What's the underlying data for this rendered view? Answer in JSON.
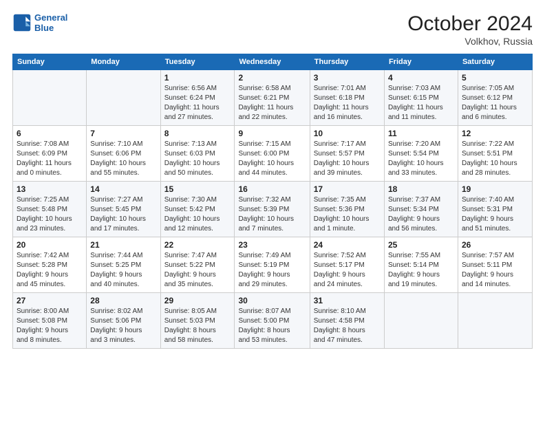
{
  "logo": {
    "line1": "General",
    "line2": "Blue"
  },
  "title": "October 2024",
  "location": "Volkhov, Russia",
  "days_header": [
    "Sunday",
    "Monday",
    "Tuesday",
    "Wednesday",
    "Thursday",
    "Friday",
    "Saturday"
  ],
  "weeks": [
    [
      {
        "day": "",
        "text": ""
      },
      {
        "day": "",
        "text": ""
      },
      {
        "day": "1",
        "text": "Sunrise: 6:56 AM\nSunset: 6:24 PM\nDaylight: 11 hours\nand 27 minutes."
      },
      {
        "day": "2",
        "text": "Sunrise: 6:58 AM\nSunset: 6:21 PM\nDaylight: 11 hours\nand 22 minutes."
      },
      {
        "day": "3",
        "text": "Sunrise: 7:01 AM\nSunset: 6:18 PM\nDaylight: 11 hours\nand 16 minutes."
      },
      {
        "day": "4",
        "text": "Sunrise: 7:03 AM\nSunset: 6:15 PM\nDaylight: 11 hours\nand 11 minutes."
      },
      {
        "day": "5",
        "text": "Sunrise: 7:05 AM\nSunset: 6:12 PM\nDaylight: 11 hours\nand 6 minutes."
      }
    ],
    [
      {
        "day": "6",
        "text": "Sunrise: 7:08 AM\nSunset: 6:09 PM\nDaylight: 11 hours\nand 0 minutes."
      },
      {
        "day": "7",
        "text": "Sunrise: 7:10 AM\nSunset: 6:06 PM\nDaylight: 10 hours\nand 55 minutes."
      },
      {
        "day": "8",
        "text": "Sunrise: 7:13 AM\nSunset: 6:03 PM\nDaylight: 10 hours\nand 50 minutes."
      },
      {
        "day": "9",
        "text": "Sunrise: 7:15 AM\nSunset: 6:00 PM\nDaylight: 10 hours\nand 44 minutes."
      },
      {
        "day": "10",
        "text": "Sunrise: 7:17 AM\nSunset: 5:57 PM\nDaylight: 10 hours\nand 39 minutes."
      },
      {
        "day": "11",
        "text": "Sunrise: 7:20 AM\nSunset: 5:54 PM\nDaylight: 10 hours\nand 33 minutes."
      },
      {
        "day": "12",
        "text": "Sunrise: 7:22 AM\nSunset: 5:51 PM\nDaylight: 10 hours\nand 28 minutes."
      }
    ],
    [
      {
        "day": "13",
        "text": "Sunrise: 7:25 AM\nSunset: 5:48 PM\nDaylight: 10 hours\nand 23 minutes."
      },
      {
        "day": "14",
        "text": "Sunrise: 7:27 AM\nSunset: 5:45 PM\nDaylight: 10 hours\nand 17 minutes."
      },
      {
        "day": "15",
        "text": "Sunrise: 7:30 AM\nSunset: 5:42 PM\nDaylight: 10 hours\nand 12 minutes."
      },
      {
        "day": "16",
        "text": "Sunrise: 7:32 AM\nSunset: 5:39 PM\nDaylight: 10 hours\nand 7 minutes."
      },
      {
        "day": "17",
        "text": "Sunrise: 7:35 AM\nSunset: 5:36 PM\nDaylight: 10 hours\nand 1 minute."
      },
      {
        "day": "18",
        "text": "Sunrise: 7:37 AM\nSunset: 5:34 PM\nDaylight: 9 hours\nand 56 minutes."
      },
      {
        "day": "19",
        "text": "Sunrise: 7:40 AM\nSunset: 5:31 PM\nDaylight: 9 hours\nand 51 minutes."
      }
    ],
    [
      {
        "day": "20",
        "text": "Sunrise: 7:42 AM\nSunset: 5:28 PM\nDaylight: 9 hours\nand 45 minutes."
      },
      {
        "day": "21",
        "text": "Sunrise: 7:44 AM\nSunset: 5:25 PM\nDaylight: 9 hours\nand 40 minutes."
      },
      {
        "day": "22",
        "text": "Sunrise: 7:47 AM\nSunset: 5:22 PM\nDaylight: 9 hours\nand 35 minutes."
      },
      {
        "day": "23",
        "text": "Sunrise: 7:49 AM\nSunset: 5:19 PM\nDaylight: 9 hours\nand 29 minutes."
      },
      {
        "day": "24",
        "text": "Sunrise: 7:52 AM\nSunset: 5:17 PM\nDaylight: 9 hours\nand 24 minutes."
      },
      {
        "day": "25",
        "text": "Sunrise: 7:55 AM\nSunset: 5:14 PM\nDaylight: 9 hours\nand 19 minutes."
      },
      {
        "day": "26",
        "text": "Sunrise: 7:57 AM\nSunset: 5:11 PM\nDaylight: 9 hours\nand 14 minutes."
      }
    ],
    [
      {
        "day": "27",
        "text": "Sunrise: 8:00 AM\nSunset: 5:08 PM\nDaylight: 9 hours\nand 8 minutes."
      },
      {
        "day": "28",
        "text": "Sunrise: 8:02 AM\nSunset: 5:06 PM\nDaylight: 9 hours\nand 3 minutes."
      },
      {
        "day": "29",
        "text": "Sunrise: 8:05 AM\nSunset: 5:03 PM\nDaylight: 8 hours\nand 58 minutes."
      },
      {
        "day": "30",
        "text": "Sunrise: 8:07 AM\nSunset: 5:00 PM\nDaylight: 8 hours\nand 53 minutes."
      },
      {
        "day": "31",
        "text": "Sunrise: 8:10 AM\nSunset: 4:58 PM\nDaylight: 8 hours\nand 47 minutes."
      },
      {
        "day": "",
        "text": ""
      },
      {
        "day": "",
        "text": ""
      }
    ]
  ]
}
